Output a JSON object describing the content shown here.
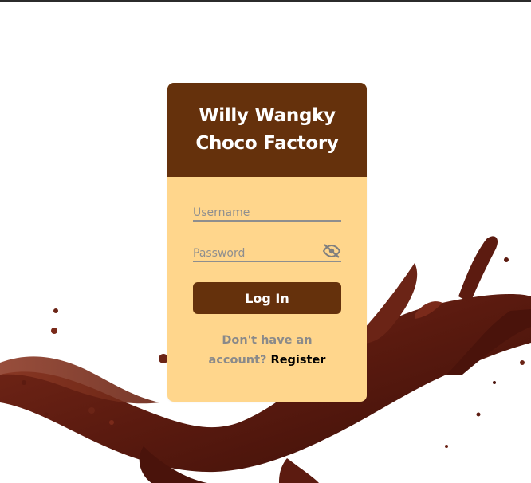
{
  "colors": {
    "brand_brown": "#65310c",
    "card_cream": "#ffd68c",
    "muted_text": "#8a8a8a",
    "link_text": "#000000"
  },
  "card": {
    "title_line1": "Willy Wangky",
    "title_line2": "Choco Factory"
  },
  "form": {
    "username_placeholder": "Username",
    "username_value": "",
    "password_placeholder": "Password",
    "password_value": "",
    "password_toggle_icon": "eye-slash-icon",
    "login_label": "Log In"
  },
  "footer": {
    "prompt_line1": "Don't have an",
    "prompt_line2": "account?",
    "register_label": "Register"
  }
}
